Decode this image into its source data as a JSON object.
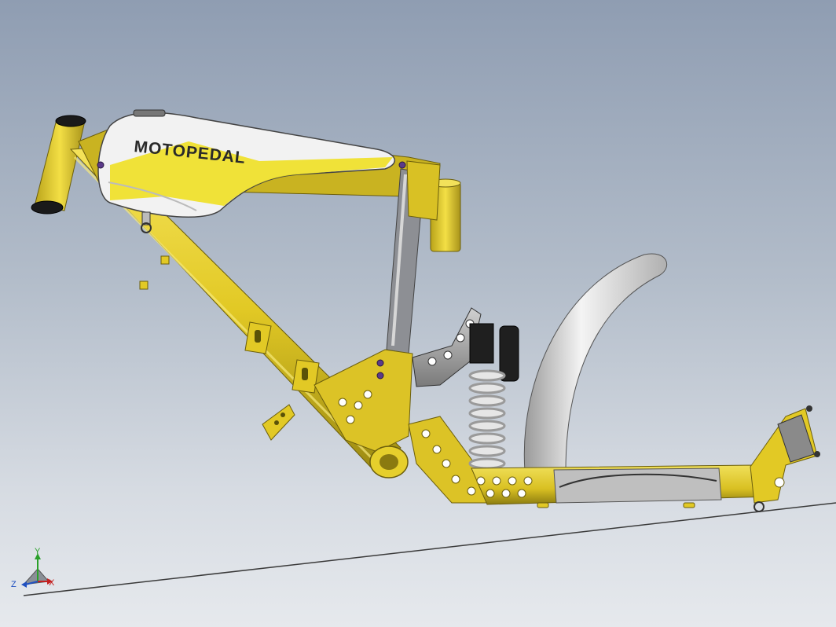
{
  "tank": {
    "brand": "MOTOPEDAL"
  },
  "triad": {
    "x_label": "X",
    "y_label": "Y",
    "z_label": "Z"
  },
  "colors": {
    "frame_yellow": "#e2c925",
    "frame_dark": "#8a7a10",
    "tank_white": "#f2f2f2",
    "tank_yellow": "#f0e024",
    "spring": "#d8d8d8",
    "fender": "#dcdcdc",
    "background_top": "#8f9db2",
    "background_bottom": "#e6e9ed"
  }
}
